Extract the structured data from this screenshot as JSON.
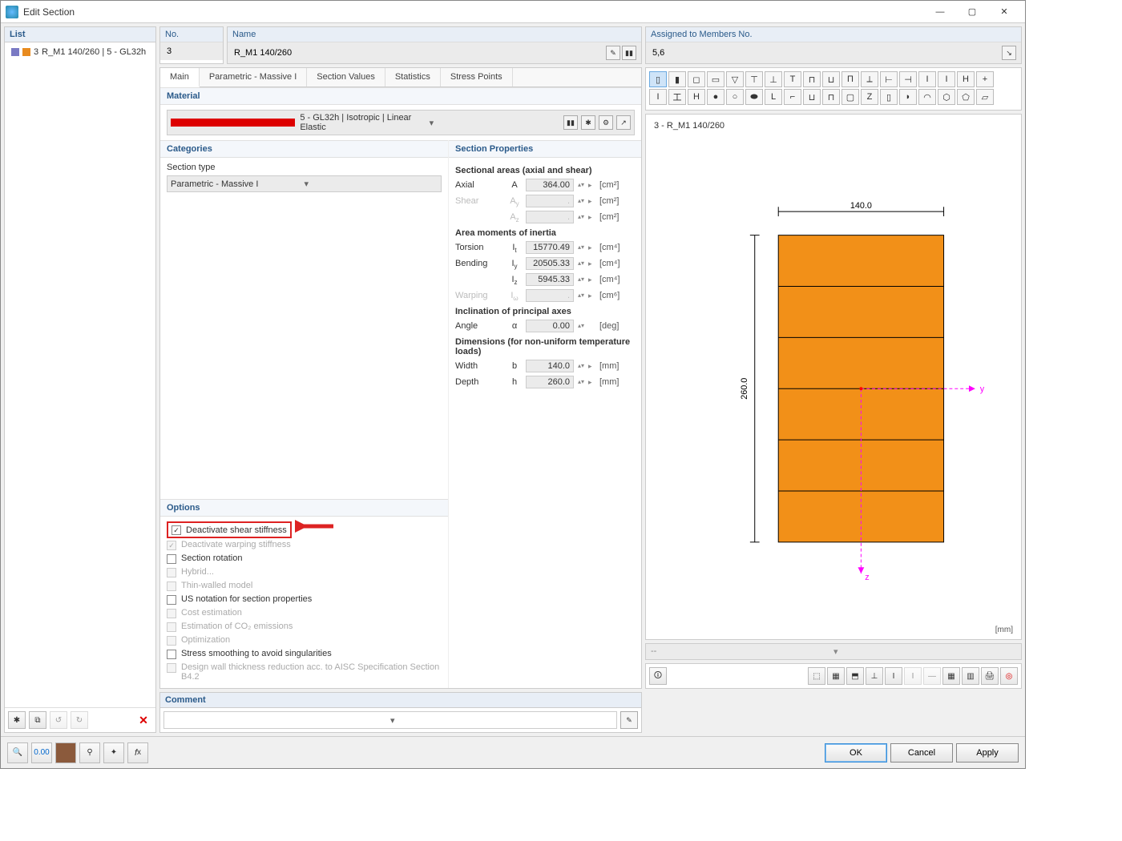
{
  "window": {
    "title": "Edit Section"
  },
  "list": {
    "header": "List",
    "item_index": "3",
    "item_text": "R_M1 140/260 | 5 - GL32h"
  },
  "top": {
    "no_label": "No.",
    "no_value": "3",
    "name_label": "Name",
    "name_value": "R_M1 140/260",
    "assigned_label": "Assigned to Members No.",
    "assigned_value": "5,6"
  },
  "tabs": {
    "main": "Main",
    "param": "Parametric - Massive I",
    "secvals": "Section Values",
    "stats": "Statistics",
    "stress": "Stress Points"
  },
  "material": {
    "header": "Material",
    "value": "5 - GL32h | Isotropic | Linear Elastic"
  },
  "categories": {
    "header": "Categories",
    "type_label": "Section type",
    "type_value": "Parametric - Massive I"
  },
  "options": {
    "header": "Options",
    "deact_shear": "Deactivate shear stiffness",
    "deact_warp": "Deactivate warping stiffness",
    "rotation": "Section rotation",
    "hybrid": "Hybrid...",
    "thinwall": "Thin-walled model",
    "usnot": "US notation for section properties",
    "cost": "Cost estimation",
    "co2": "Estimation of CO₂ emissions",
    "opt": "Optimization",
    "smooth": "Stress smoothing to avoid singularities",
    "aisc": "Design wall thickness reduction acc. to AISC Specification Section B4.2"
  },
  "props": {
    "header": "Section Properties",
    "areas_hdr": "Sectional areas (axial and shear)",
    "axial": "Axial",
    "axial_sym": "A",
    "axial_val": "364.00",
    "unit_cm2": "[cm²]",
    "shear": "Shear",
    "ay": "Aᵧ",
    "az": "A_z",
    "inertia_hdr": "Area moments of inertia",
    "torsion": "Torsion",
    "it": "Iₜ",
    "it_val": "15770.49",
    "unit_cm4": "[cm⁴]",
    "bending": "Bending",
    "iy": "Iᵧ",
    "iy_val": "20505.33",
    "iz": "I_z",
    "iz_val": "5945.33",
    "warping": "Warping",
    "iw": "Iω",
    "unit_cm6": "[cm⁶]",
    "incl_hdr": "Inclination of principal axes",
    "angle": "Angle",
    "alpha": "α",
    "alpha_val": "0.00",
    "unit_deg": "[deg]",
    "dim_hdr": "Dimensions (for non-uniform temperature loads)",
    "width": "Width",
    "b": "b",
    "b_val": "140.0",
    "unit_mm": "[mm]",
    "depth": "Depth",
    "h": "h",
    "h_val": "260.0"
  },
  "preview": {
    "title": "3 - R_M1 140/260",
    "w": "140.0",
    "h": "260.0",
    "y": "y",
    "z": "z",
    "units": "[mm]",
    "combo": "--"
  },
  "comment": {
    "header": "Comment"
  },
  "buttons": {
    "ok": "OK",
    "cancel": "Cancel",
    "apply": "Apply"
  }
}
